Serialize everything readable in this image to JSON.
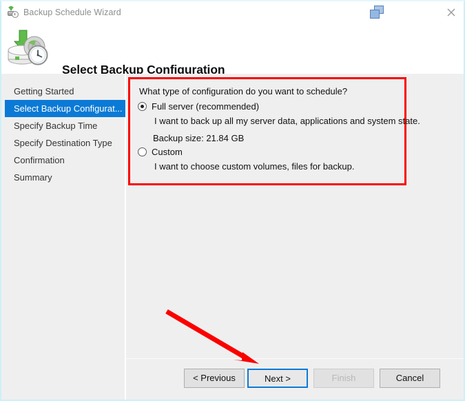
{
  "window": {
    "titlebar": {
      "icon": "backup-schedule-icon",
      "title": "Backup Schedule Wizard",
      "cascade_icon": "cascade-windows-icon",
      "close_icon": "close-icon"
    },
    "header": {
      "icon": "backup-wizard-large-icon",
      "title": "Select Backup Configuration"
    }
  },
  "sidebar": {
    "items": [
      {
        "label": "Getting Started",
        "selected": false
      },
      {
        "label": "Select Backup Configurat...",
        "selected": true
      },
      {
        "label": "Specify Backup Time",
        "selected": false
      },
      {
        "label": "Specify Destination Type",
        "selected": false
      },
      {
        "label": "Confirmation",
        "selected": false
      },
      {
        "label": "Summary",
        "selected": false
      }
    ]
  },
  "main": {
    "question": "What type of configuration do you want to schedule?",
    "options": [
      {
        "label": "Full server (recommended)",
        "checked": true,
        "description": "I want to back up all my server data, applications and system state.",
        "detail": "Backup size: 21.84 GB"
      },
      {
        "label": "Custom",
        "checked": false,
        "description": "I want to choose custom volumes, files for backup.",
        "detail": ""
      }
    ]
  },
  "footer": {
    "buttons": [
      {
        "label": "< Previous",
        "state": "enabled"
      },
      {
        "label": "Next >",
        "state": "focused"
      },
      {
        "label": "Finish",
        "state": "disabled"
      },
      {
        "label": "Cancel",
        "state": "enabled"
      }
    ]
  },
  "annotations": {
    "highlight_box_color": "#fb0000",
    "arrow_color": "#fb0000",
    "arrow_target": "next-button"
  },
  "colors": {
    "accent": "#0b7ad6",
    "panel_bg": "#efefef",
    "titlebar_text": "#8d8d8d",
    "window_border": "#cdf0f7"
  }
}
